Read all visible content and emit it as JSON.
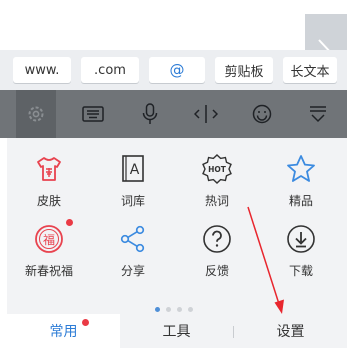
{
  "shortcuts": [
    "www.",
    ".com",
    "@",
    "剪贴板",
    "长文本"
  ],
  "colors": {
    "icon_red": "#e8434f",
    "icon_blue": "#3c8be0",
    "accent": "#2d7cd6",
    "annotation": "#e8262e"
  },
  "toolbar": {
    "icons": [
      "settings-icon",
      "keyboard-icon",
      "microphone-icon",
      "cursor-icon",
      "emoji-icon",
      "hide-keyboard-icon"
    ]
  },
  "grid": {
    "skin": "皮肤",
    "lexicon": "词库",
    "hot_words": "热词",
    "featured": "精品",
    "greetings": "新春祝福",
    "share": "分享",
    "feedback": "反馈",
    "download": "下载"
  },
  "hot_badge": "HOT",
  "fu_char": "福",
  "lexicon_letter": "A",
  "tabs": {
    "common": "常用",
    "tools": "工具",
    "settings": "设置"
  },
  "pager": {
    "pages": 4,
    "current": 1
  }
}
